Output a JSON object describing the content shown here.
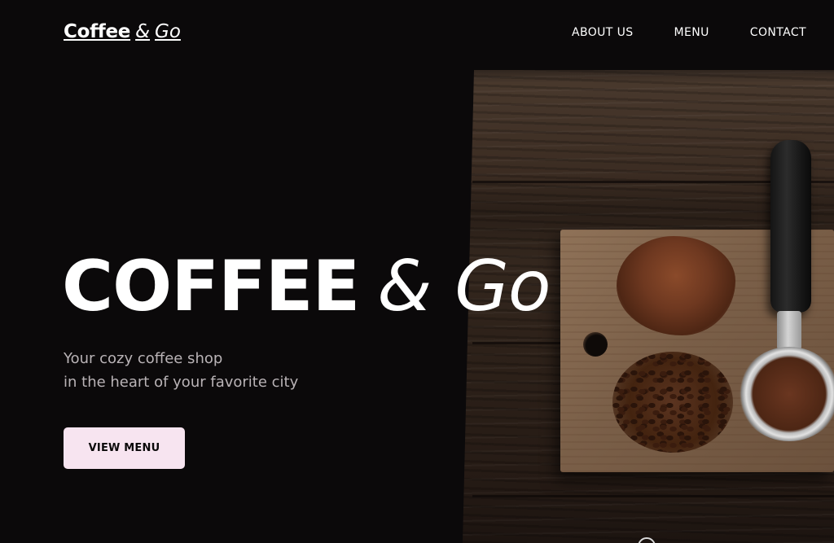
{
  "header": {
    "logo": {
      "word1": "Coffee",
      "amp": "&",
      "word2": "Go"
    },
    "nav": [
      {
        "label": "ABOUT US"
      },
      {
        "label": "MENU"
      },
      {
        "label": "CONTACT"
      }
    ]
  },
  "hero": {
    "title_main": "COFFEE",
    "title_amp": "&",
    "title_italic": "Go",
    "subtitle_line1": "Your cozy coffee shop",
    "subtitle_line2": "in the heart of your favorite city",
    "cta_label": "VIEW MENU",
    "image": {
      "icon": "coffee-photo",
      "alt_semantic": "ground coffee, beans and portafilter on wooden board"
    }
  },
  "colors": {
    "background": "#0b090a",
    "text": "#ffffff",
    "subtitle": "#b9b3b6",
    "cta_bg": "#f7e4f0",
    "cta_text": "#0b090a"
  }
}
